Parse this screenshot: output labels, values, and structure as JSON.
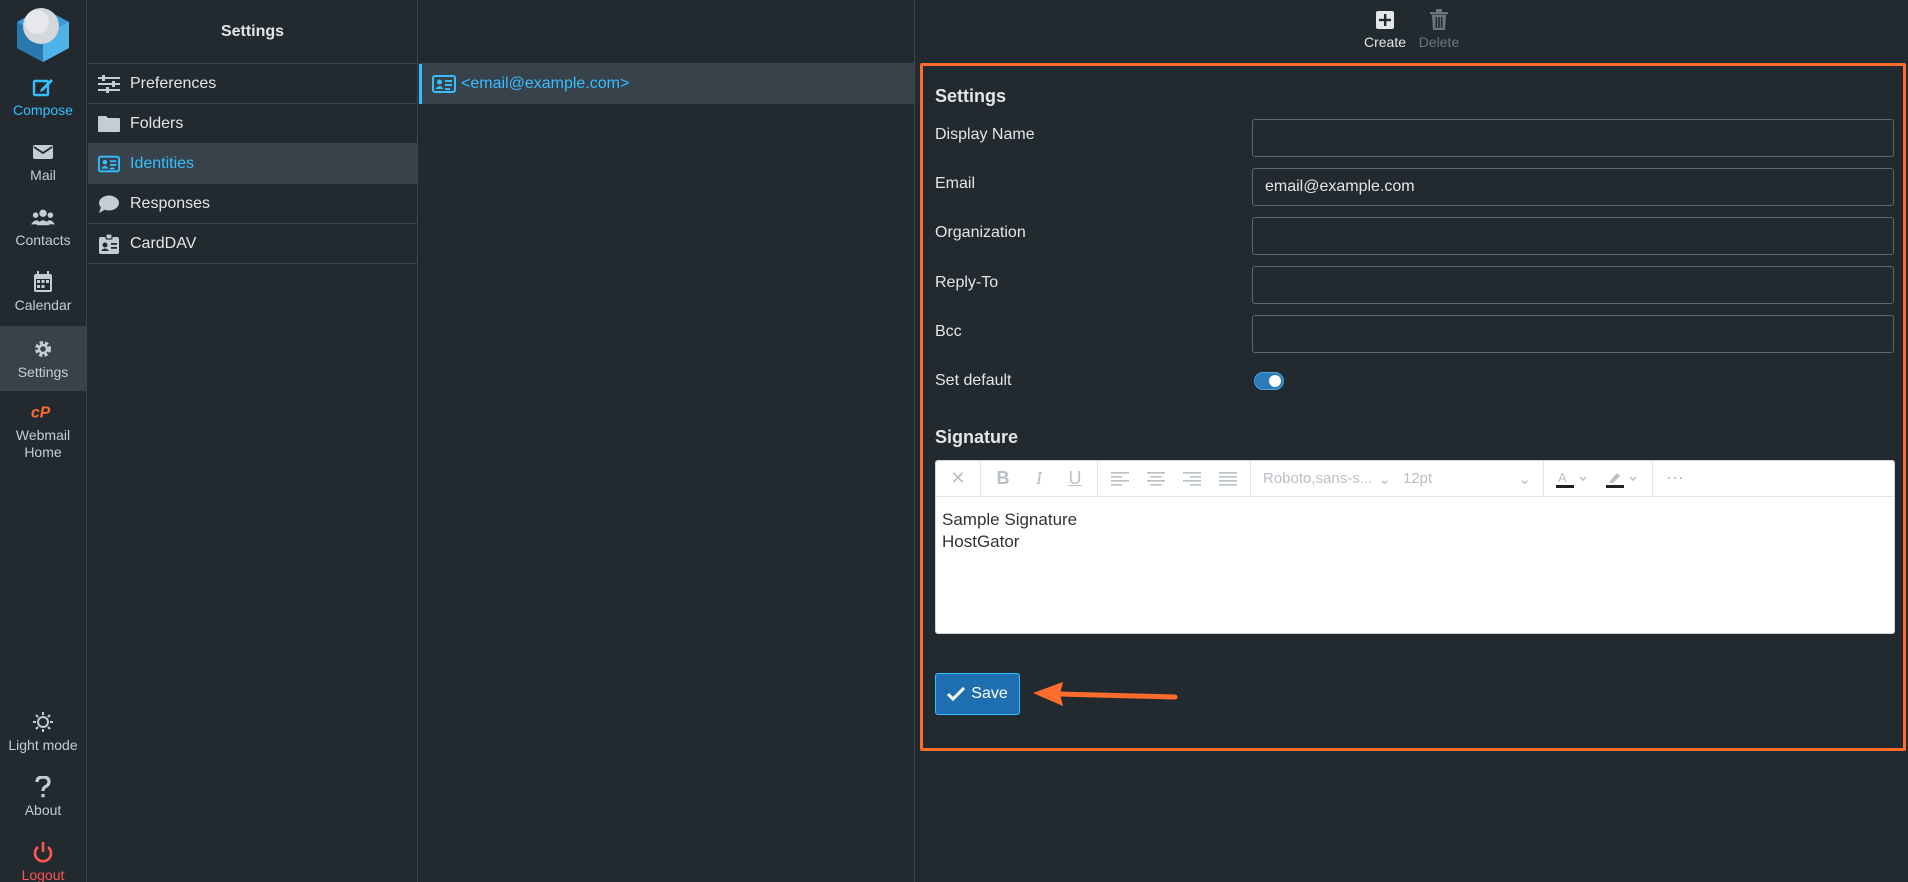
{
  "rail": {
    "compose": "Compose",
    "mail": "Mail",
    "contacts": "Contacts",
    "calendar": "Calendar",
    "settings": "Settings",
    "webmail_home_line1": "Webmail",
    "webmail_home_line2": "Home",
    "light_mode": "Light mode",
    "about": "About",
    "logout": "Logout"
  },
  "menu": {
    "header": "Settings",
    "items": [
      {
        "label": "Preferences",
        "icon": "sliders-icon"
      },
      {
        "label": "Folders",
        "icon": "folder-icon"
      },
      {
        "label": "Identities",
        "icon": "id-card-icon",
        "active": true
      },
      {
        "label": "Responses",
        "icon": "speech-bubble-icon"
      },
      {
        "label": "CardDAV",
        "icon": "contact-badge-icon"
      }
    ]
  },
  "identities": {
    "items": [
      {
        "label": "<email@example.com>"
      }
    ]
  },
  "toolbar": {
    "create": "Create",
    "delete": "Delete"
  },
  "form": {
    "settings_title": "Settings",
    "display_name_label": "Display Name",
    "display_name_value": "",
    "email_label": "Email",
    "email_value": "email@example.com",
    "organization_label": "Organization",
    "organization_value": "",
    "reply_to_label": "Reply-To",
    "reply_to_value": "",
    "bcc_label": "Bcc",
    "bcc_value": "",
    "set_default_label": "Set default",
    "set_default_on": true,
    "signature_title": "Signature",
    "editor": {
      "font_family": "Roboto,sans-s...",
      "font_size": "12pt",
      "signature_line1": "Sample Signature",
      "signature_line2": "HostGator"
    },
    "save_label": "Save"
  },
  "colors": {
    "accent": "#37beff",
    "highlight_frame": "#ff6c2c",
    "logout": "#ff5552",
    "save_button": "#1e6fb1"
  }
}
